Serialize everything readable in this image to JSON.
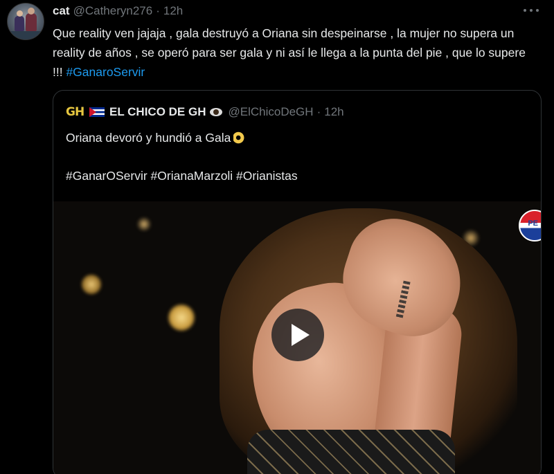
{
  "tweet": {
    "author_name": "cat",
    "author_handle": "@Catheryn276",
    "separator": "·",
    "time": "12h",
    "text": "Que reality ven jajaja , gala destruyó a Oriana sin despeinarse , la mujer no supera un reality de años , se operó para ser gala y ni así le llega a la punta del pie , que lo supere !!! ",
    "hashtag": "#GanaroServir"
  },
  "quote": {
    "logo_text": "GH",
    "author_name": "EL CHICO DE GH",
    "author_handle": "@ElChicoDeGH",
    "separator": "·",
    "time": "12h",
    "text": "Oriana devoró y hundió a Gala",
    "hashtags": "#GanarOServir #OrianaMarzoli #Orianistas"
  },
  "media": {
    "sponsor_label": "PE",
    "icon": "play-icon"
  },
  "icons": {
    "more": "more-options-icon",
    "flag": "cuba-flag-icon",
    "eye": "eye-icon",
    "ok_hand": "ok-hand-emoji"
  },
  "colors": {
    "background": "#000000",
    "text": "#e7e9ea",
    "muted": "#71767b",
    "link": "#1d9bf0",
    "border": "#2f3336"
  }
}
